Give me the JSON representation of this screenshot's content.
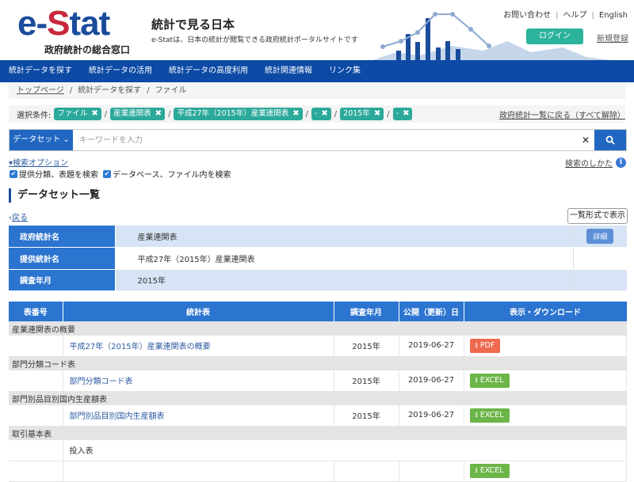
{
  "header": {
    "logo_main": "e-Stat",
    "logo_sub": "政府統計の総合窓口",
    "site_title": "統計で見る日本",
    "site_desc": "e-Statは、日本の統計が閲覧できる政府統計ポータルサイトです",
    "links": [
      "お問い合わせ",
      "ヘルプ",
      "English"
    ],
    "login": "ログイン",
    "register": "新規登録"
  },
  "nav": [
    "統計データを探す",
    "統計データの活用",
    "統計データの高度利用",
    "統計関連情報",
    "リンク集"
  ],
  "breadcrumb": [
    "トップページ",
    "統計データを探す",
    "ファイル"
  ],
  "conditions": {
    "label": "選択条件:",
    "chips": [
      "ファイル",
      "産業連関表",
      "平成27年（2015年）産業連関表",
      "-",
      "2015年",
      "-"
    ],
    "reset": "政府統計一覧に戻る（すべて解除）"
  },
  "search": {
    "type": "データセット",
    "placeholder": "キーワードを入力",
    "value": "",
    "options_link": "検索オプション",
    "howto": "検索のしかた",
    "checks": [
      {
        "label": "提供分類、表題を検索",
        "checked": true
      },
      {
        "label": "データベース、ファイル内を検索",
        "checked": true
      }
    ]
  },
  "section_title": "データセット一覧",
  "back": "戻る",
  "list_view": "一覧形式で表示",
  "info": {
    "rows": [
      {
        "label": "政府統計名",
        "value": "産業連関表",
        "action": "詳細"
      },
      {
        "label": "提供統計名",
        "value": "平成27年（2015年）産業連関表"
      },
      {
        "label": "調査年月",
        "value": "2015年"
      }
    ]
  },
  "table": {
    "headers": [
      "表番号",
      "統計表",
      "調査年月",
      "公開（更新）日",
      "表示・ダウンロード"
    ],
    "groups": [
      {
        "name": "産業連関表の概要",
        "items": [
          {
            "title": "平成27年（2015年）産業連関表の概要",
            "year": "2015年",
            "date": "2019-06-27",
            "dl": "PDF",
            "link": true
          }
        ]
      },
      {
        "name": "部門分類コード表",
        "items": [
          {
            "title": "部門分類コード表",
            "year": "2015年",
            "date": "2019-06-27",
            "dl": "EXCEL",
            "link": true
          }
        ]
      },
      {
        "name": "部門別品目別国内生産額表",
        "items": [
          {
            "title": "部門別品目別国内生産額表",
            "year": "2015年",
            "date": "2019-06-27",
            "dl": "EXCEL",
            "link": true
          }
        ]
      },
      {
        "name": "取引基本表",
        "items": [
          {
            "title": "投入表",
            "year": "",
            "date": "",
            "dl": "",
            "link": false
          }
        ]
      }
    ]
  },
  "colors": {
    "brand": "#0c4aa5",
    "accent": "#2ba99a",
    "pdf": "#ef6a4f",
    "excel": "#6cb548"
  }
}
